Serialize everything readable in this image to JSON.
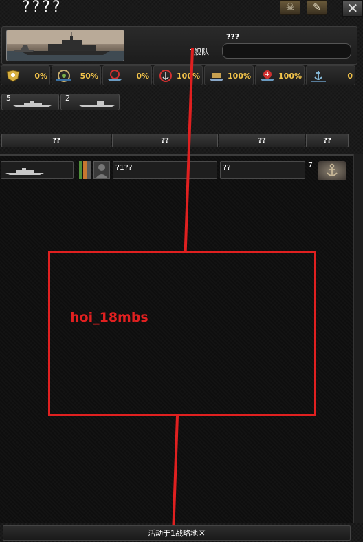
{
  "title": "????",
  "header_buttons": [
    "skull-icon",
    "document-icon"
  ],
  "close_label": "✕",
  "fleet": {
    "name": "???",
    "count_label": "1舰队",
    "name_input_value": ""
  },
  "stats": [
    {
      "icon": "admiral-badge-icon",
      "value": "0%"
    },
    {
      "icon": "gear-wheel-icon",
      "value": "50%"
    },
    {
      "icon": "target-ship-icon",
      "value": "0%"
    },
    {
      "icon": "anchor-target-icon",
      "value": "100%"
    },
    {
      "icon": "fleet-cargo-icon",
      "value": "100%"
    },
    {
      "icon": "repair-ship-icon",
      "value": "100%"
    },
    {
      "icon": "anchor-icon",
      "value": "0"
    }
  ],
  "ship_types": [
    {
      "icon": "battleship-icon",
      "count": "5"
    },
    {
      "icon": "submarine-icon",
      "count": "2"
    }
  ],
  "columns": [
    "??",
    "??",
    "??",
    "??"
  ],
  "ship_row": {
    "name": "?1??",
    "status": "??",
    "count": "7",
    "colors": {
      "green": "#4f8f3a",
      "orange": "#c87830"
    }
  },
  "annotation": {
    "text": "hoi_18mbs",
    "color": "#e02020"
  },
  "footer": {
    "label": "活动于1战略地区"
  }
}
